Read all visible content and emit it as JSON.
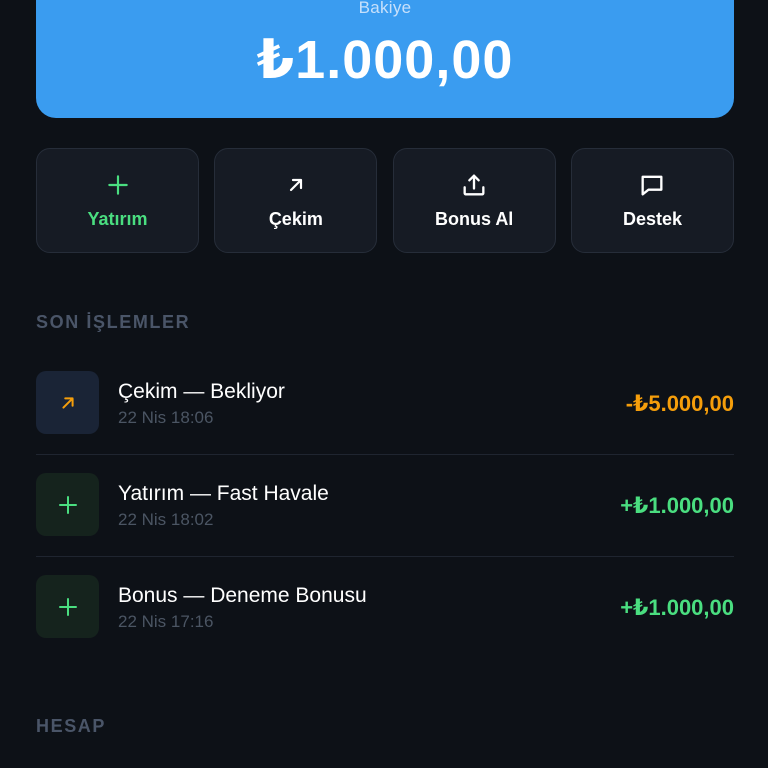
{
  "balance": {
    "label": "Bakiye",
    "amount": "₺1.000,00"
  },
  "actions": [
    {
      "label": "Yatırım",
      "icon": "plus-icon"
    },
    {
      "label": "Çekim",
      "icon": "arrow-up-right-icon"
    },
    {
      "label": "Bonus Al",
      "icon": "upload-icon"
    },
    {
      "label": "Destek",
      "icon": "message-icon"
    }
  ],
  "recent": {
    "title": "SON İŞLEMLER",
    "items": [
      {
        "title": "Çekim — Bekliyor",
        "time": "22 Nis 18:06",
        "amount": "-₺5.000,00",
        "icon": "arrow-up-right-icon"
      },
      {
        "title": "Yatırım — Fast Havale",
        "time": "22 Nis 18:02",
        "amount": "+₺1.000,00",
        "icon": "plus-icon"
      },
      {
        "title": "Bonus — Deneme Bonusu",
        "time": "22 Nis 17:16",
        "amount": "+₺1.000,00",
        "icon": "plus-icon"
      }
    ]
  },
  "account": {
    "title": "HESAP"
  },
  "colors": {
    "accent": "#3a9cf0",
    "positive": "#4ade80",
    "pending": "#f59e0b",
    "background": "#0d1117"
  }
}
